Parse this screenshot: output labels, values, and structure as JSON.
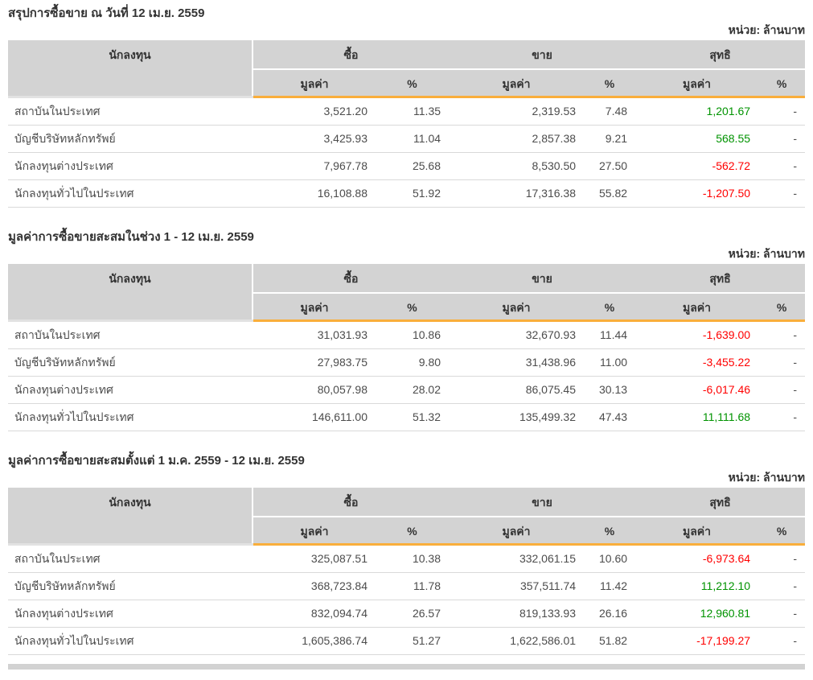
{
  "unit_label": "หน่วย: ล้านบาท",
  "columns": {
    "investor": "นักลงทุน",
    "buy": "ซื้อ",
    "sell": "ขาย",
    "net": "สุทธิ",
    "value": "มูลค่า",
    "percent": "%"
  },
  "colors": {
    "header_bg": "#d3d3d3",
    "accent_orange": "#f9ae3b",
    "positive_green": "#009300",
    "negative_red": "#ff0000"
  },
  "sections": [
    {
      "title": "สรุปการซื้อขาย ณ วันที่ 12 เม.ย. 2559",
      "rows": [
        {
          "investor": "สถาบันในประเทศ",
          "buy_value": "3,521.20",
          "buy_pct": "11.35",
          "sell_value": "2,319.53",
          "sell_pct": "7.48",
          "net_value": "1,201.67",
          "net_trend": "up",
          "net_pct": "-"
        },
        {
          "investor": "บัญชีบริษัทหลักทรัพย์",
          "buy_value": "3,425.93",
          "buy_pct": "11.04",
          "sell_value": "2,857.38",
          "sell_pct": "9.21",
          "net_value": "568.55",
          "net_trend": "up",
          "net_pct": "-"
        },
        {
          "investor": "นักลงทุนต่างประเทศ",
          "buy_value": "7,967.78",
          "buy_pct": "25.68",
          "sell_value": "8,530.50",
          "sell_pct": "27.50",
          "net_value": "-562.72",
          "net_trend": "down",
          "net_pct": "-"
        },
        {
          "investor": "นักลงทุนทั่วไปในประเทศ",
          "buy_value": "16,108.88",
          "buy_pct": "51.92",
          "sell_value": "17,316.38",
          "sell_pct": "55.82",
          "net_value": "-1,207.50",
          "net_trend": "down",
          "net_pct": "-"
        }
      ]
    },
    {
      "title": "มูลค่าการซื้อขายสะสมในช่วง 1 - 12 เม.ย. 2559",
      "rows": [
        {
          "investor": "สถาบันในประเทศ",
          "buy_value": "31,031.93",
          "buy_pct": "10.86",
          "sell_value": "32,670.93",
          "sell_pct": "11.44",
          "net_value": "-1,639.00",
          "net_trend": "down",
          "net_pct": "-"
        },
        {
          "investor": "บัญชีบริษัทหลักทรัพย์",
          "buy_value": "27,983.75",
          "buy_pct": "9.80",
          "sell_value": "31,438.96",
          "sell_pct": "11.00",
          "net_value": "-3,455.22",
          "net_trend": "down",
          "net_pct": "-"
        },
        {
          "investor": "นักลงทุนต่างประเทศ",
          "buy_value": "80,057.98",
          "buy_pct": "28.02",
          "sell_value": "86,075.45",
          "sell_pct": "30.13",
          "net_value": "-6,017.46",
          "net_trend": "down",
          "net_pct": "-"
        },
        {
          "investor": "นักลงทุนทั่วไปในประเทศ",
          "buy_value": "146,611.00",
          "buy_pct": "51.32",
          "sell_value": "135,499.32",
          "sell_pct": "47.43",
          "net_value": "11,111.68",
          "net_trend": "up",
          "net_pct": "-"
        }
      ]
    },
    {
      "title": "มูลค่าการซื้อขายสะสมตั้งแต่ 1 ม.ค. 2559 - 12 เม.ย. 2559",
      "rows": [
        {
          "investor": "สถาบันในประเทศ",
          "buy_value": "325,087.51",
          "buy_pct": "10.38",
          "sell_value": "332,061.15",
          "sell_pct": "10.60",
          "net_value": "-6,973.64",
          "net_trend": "down",
          "net_pct": "-"
        },
        {
          "investor": "บัญชีบริษัทหลักทรัพย์",
          "buy_value": "368,723.84",
          "buy_pct": "11.78",
          "sell_value": "357,511.74",
          "sell_pct": "11.42",
          "net_value": "11,212.10",
          "net_trend": "up",
          "net_pct": "-"
        },
        {
          "investor": "นักลงทุนต่างประเทศ",
          "buy_value": "832,094.74",
          "buy_pct": "26.57",
          "sell_value": "819,133.93",
          "sell_pct": "26.16",
          "net_value": "12,960.81",
          "net_trend": "up",
          "net_pct": "-"
        },
        {
          "investor": "นักลงทุนทั่วไปในประเทศ",
          "buy_value": "1,605,386.74",
          "buy_pct": "51.27",
          "sell_value": "1,622,586.01",
          "sell_pct": "51.82",
          "net_value": "-17,199.27",
          "net_trend": "down",
          "net_pct": "-"
        }
      ]
    }
  ]
}
